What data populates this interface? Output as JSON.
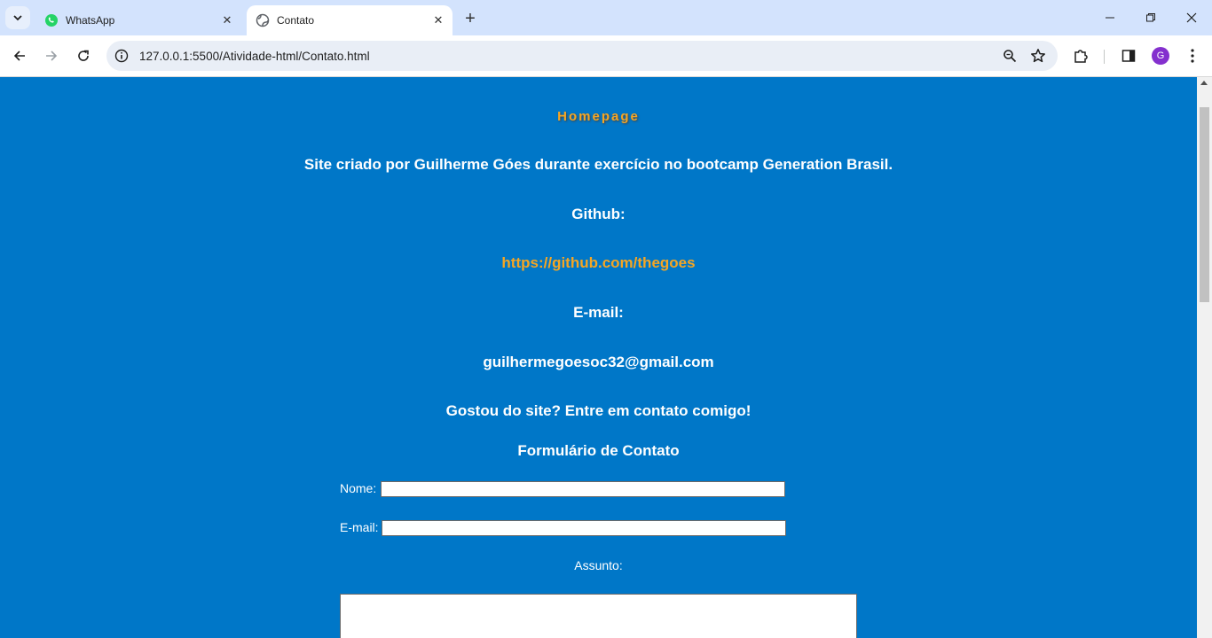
{
  "browser": {
    "tabs": [
      {
        "title": "WhatsApp",
        "icon": "whatsapp-icon",
        "active": false
      },
      {
        "title": "Contato",
        "icon": "globe-icon",
        "active": true
      }
    ],
    "url": "127.0.0.1:5500/Atividade-html/Contato.html",
    "profile_initial": "G"
  },
  "page": {
    "home_link": "Homepage",
    "intro": "Site criado por Guilherme Góes durante exercício no bootcamp Generation Brasil.",
    "github_label": "Github:",
    "github_url": "https://github.com/thegoes",
    "email_label": "E-mail:",
    "email_value": "guilhermegoesoc32@gmail.com",
    "cta": "Gostou do site? Entre em contato comigo!",
    "form_title": "Formulário de Contato",
    "form": {
      "name_label": "Nome:",
      "email_label": "E-mail:",
      "subject_label": "Assunto:"
    }
  },
  "colors": {
    "page_bg": "#0077c8",
    "accent": "#f5a623",
    "tabstrip": "#d3e3fd"
  }
}
